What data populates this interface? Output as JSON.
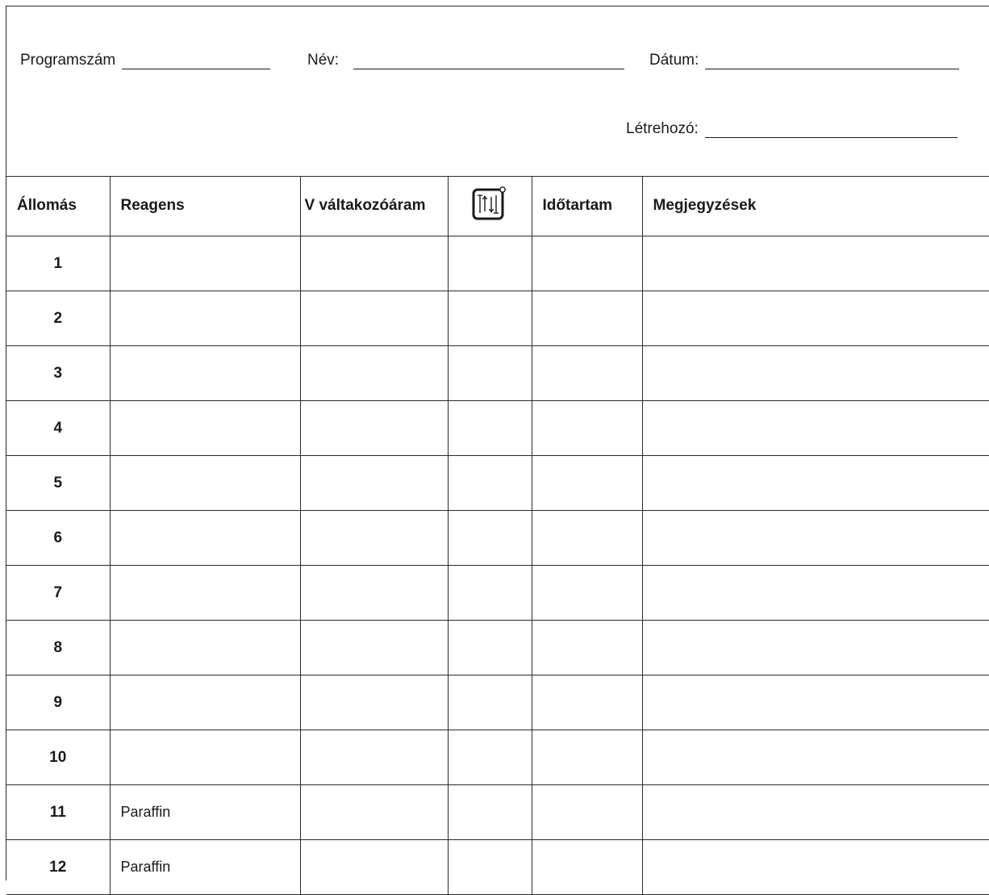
{
  "header": {
    "program_label": "Programszám",
    "name_label": "Név:",
    "date_label": "Dátum:",
    "creator_label": "Létrehozó:"
  },
  "table": {
    "columns": [
      "Állomás",
      "Reagens",
      "V váltakozóáram",
      "Időtartam",
      "Megjegyzések"
    ],
    "icon_column": "vacuum-pressure-icon",
    "rows": [
      {
        "station": "1",
        "reagent": ""
      },
      {
        "station": "2",
        "reagent": ""
      },
      {
        "station": "3",
        "reagent": ""
      },
      {
        "station": "4",
        "reagent": ""
      },
      {
        "station": "5",
        "reagent": ""
      },
      {
        "station": "6",
        "reagent": ""
      },
      {
        "station": "7",
        "reagent": ""
      },
      {
        "station": "8",
        "reagent": ""
      },
      {
        "station": "9",
        "reagent": ""
      },
      {
        "station": "10",
        "reagent": ""
      },
      {
        "station": "11",
        "reagent": "Paraffin"
      },
      {
        "station": "12",
        "reagent": "Paraffin"
      }
    ]
  }
}
